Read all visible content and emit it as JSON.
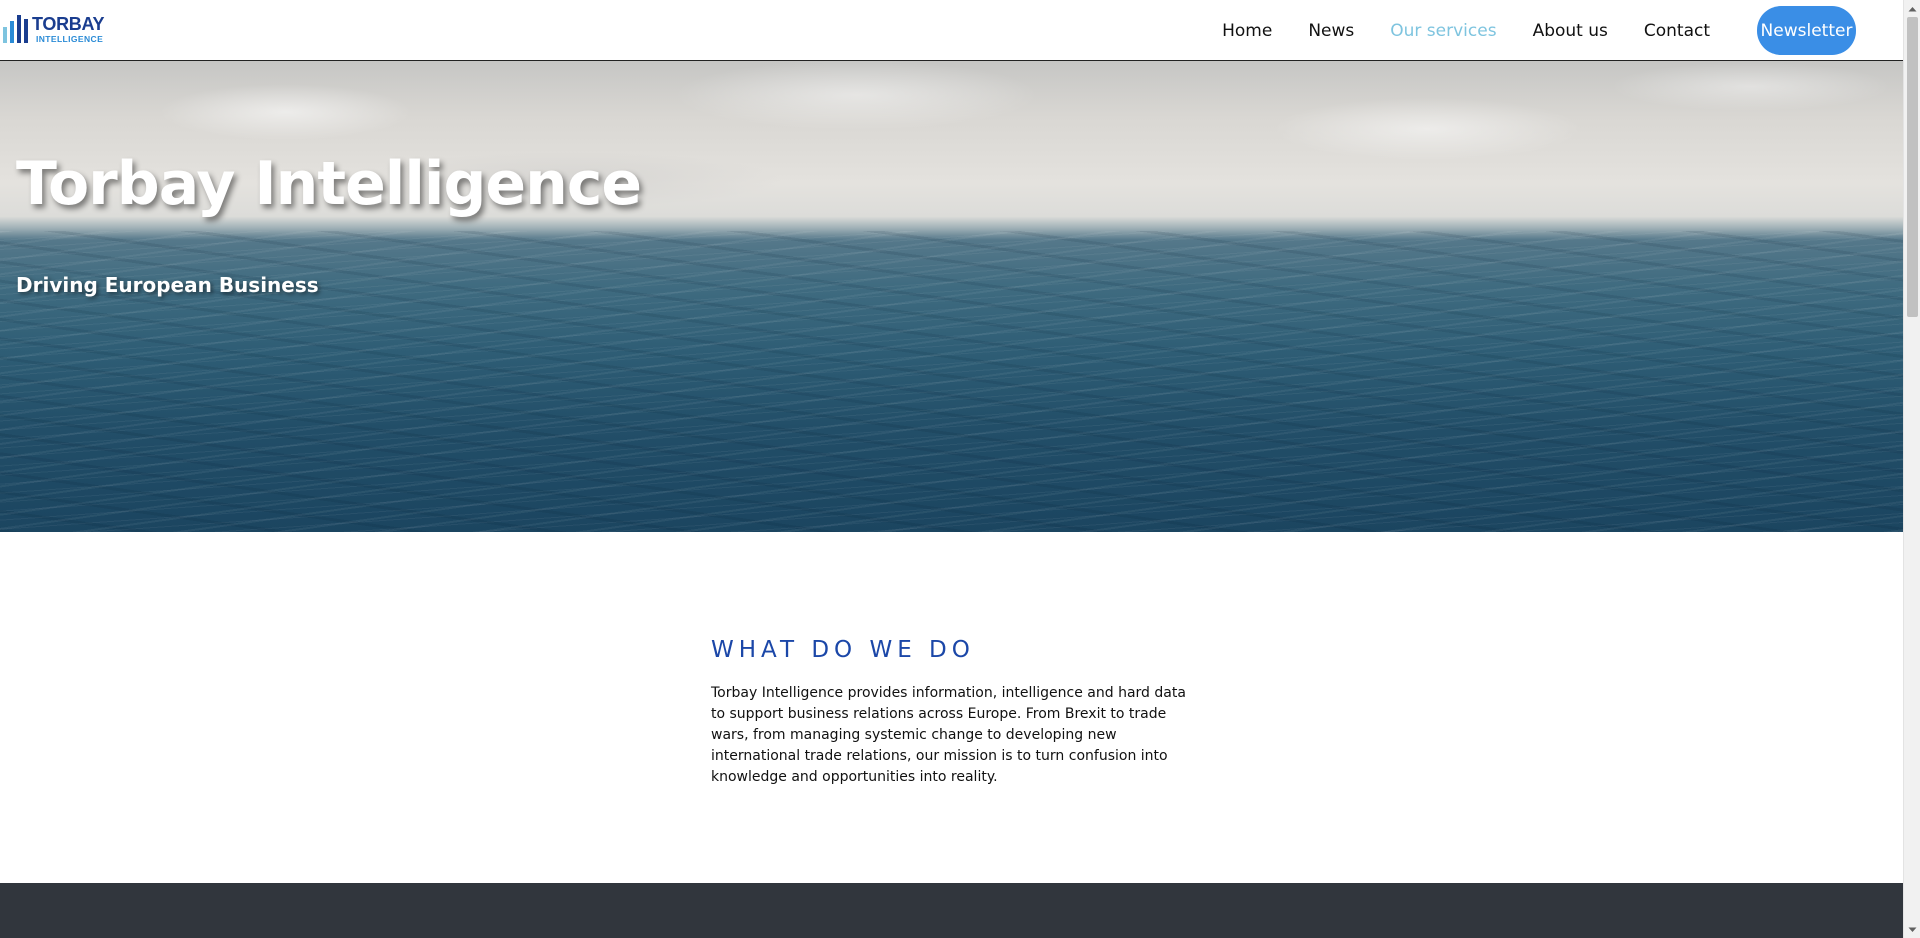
{
  "brand": {
    "name": "TORBAY",
    "tagline": "INTELLIGENCE",
    "bar_colors": [
      "#7ec4df",
      "#2a8bd6",
      "#1a3d8f",
      "#1a3d8f"
    ]
  },
  "nav": {
    "items": [
      {
        "label": "Home",
        "active": false
      },
      {
        "label": "News",
        "active": false
      },
      {
        "label": "Our services",
        "active": true
      },
      {
        "label": "About us",
        "active": false
      },
      {
        "label": "Contact",
        "active": false
      }
    ],
    "newsletter_label": "Newsletter"
  },
  "hero": {
    "title": "Torbay Intelligence",
    "subtitle": "Driving European Business"
  },
  "section": {
    "heading": "WHAT DO WE DO",
    "body": "Torbay Intelligence provides information, intelligence and hard data to support business relations across Europe. From Brexit to trade wars, from managing systemic change to developing new international trade relations, our mission is to turn confusion into knowledge and opportunities into reality."
  },
  "colors": {
    "accent": "#3a8ee6",
    "active_nav": "#7ec4df",
    "heading": "#1b47a8",
    "footer": "#31363d"
  },
  "icons": {
    "scroll_up": "chevron-up-icon",
    "scroll_down": "chevron-down-icon"
  }
}
